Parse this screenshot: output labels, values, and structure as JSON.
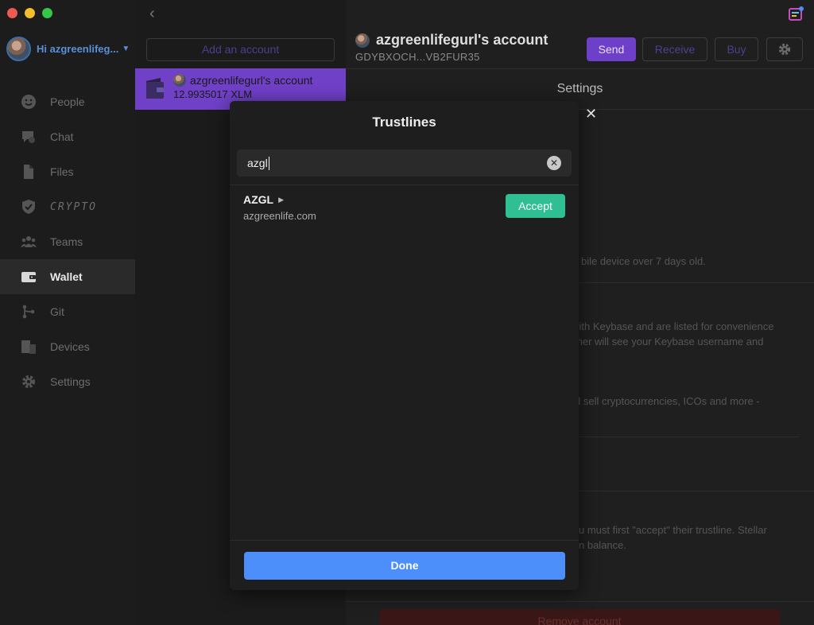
{
  "sidebar": {
    "user_greeting": "Hi azgreenlifeg...",
    "items": [
      {
        "label": "People",
        "icon": "people-icon"
      },
      {
        "label": "Chat",
        "icon": "chat-icon"
      },
      {
        "label": "Files",
        "icon": "files-icon"
      },
      {
        "label": "CRYPTO",
        "icon": "shield-icon"
      },
      {
        "label": "Teams",
        "icon": "teams-icon"
      },
      {
        "label": "Wallet",
        "icon": "wallet-icon",
        "active": true
      },
      {
        "label": "Git",
        "icon": "git-icon"
      },
      {
        "label": "Devices",
        "icon": "devices-icon"
      },
      {
        "label": "Settings",
        "icon": "gear-icon"
      }
    ]
  },
  "accounts": {
    "add_label": "Add an account",
    "selected": {
      "name": "azgreenlifegurl's account",
      "balance": "12.9935017 XLM"
    }
  },
  "main": {
    "title": "azgreenlifegurl's account",
    "address": "GDYBXOCH...VB2FUR35",
    "send_label": "Send",
    "receive_label": "Receive",
    "buy_label": "Buy",
    "settings_title": "Settings",
    "bg_line_1": "bile device over 7 days old.",
    "bg_line_2": "vith Keybase and are listed for convenience",
    "bg_line_3": "tner will see your Keybase username and",
    "bg_line_4": "d sell cryptocurrencies, ICOs and more -",
    "bg_line_5": "u must first \"accept\" their trustline. Stellar",
    "bg_line_6": "n balance.",
    "remove_label": "Remove account"
  },
  "modal": {
    "title": "Trustlines",
    "search_value": "azgl",
    "results": [
      {
        "code": "AZGL",
        "domain": "azgreenlife.com",
        "action": "Accept"
      }
    ],
    "done_label": "Done"
  },
  "colors": {
    "accent_purple": "#6e3fc8",
    "accept_green": "#2fbf92",
    "done_blue": "#4c8ffb",
    "link_blue": "#5a8fd8"
  }
}
